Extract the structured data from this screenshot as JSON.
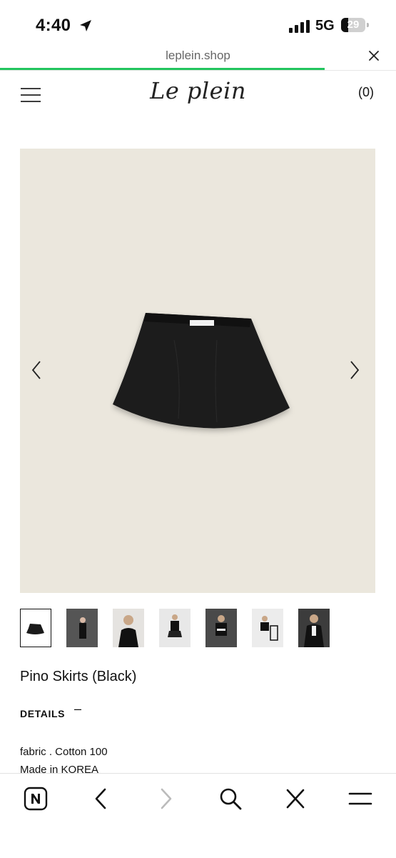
{
  "status_bar": {
    "time": "4:40",
    "network": "5G",
    "battery_level": "29",
    "battery_fraction": 0.29
  },
  "browser": {
    "url": "leplein.shop",
    "load_progress": 0.82
  },
  "site": {
    "logo": "Le plein",
    "cart": "(0)"
  },
  "product": {
    "name": "Pino Skirts (Black)",
    "details_heading": "DETAILS",
    "details_toggle": "–",
    "fabric": "fabric . Cotton 100",
    "origin": "Made in KOREA",
    "thumbnails_count": 7,
    "selected_thumbnail": 1
  },
  "colors": {
    "progress": "#22c55e",
    "image_background": "#ebe7dd",
    "skirt": "#1a1a1a"
  },
  "icons": {
    "toolbar": [
      "naver-n-icon",
      "back-icon",
      "forward-icon",
      "search-icon",
      "close-icon",
      "menu-icon"
    ]
  }
}
